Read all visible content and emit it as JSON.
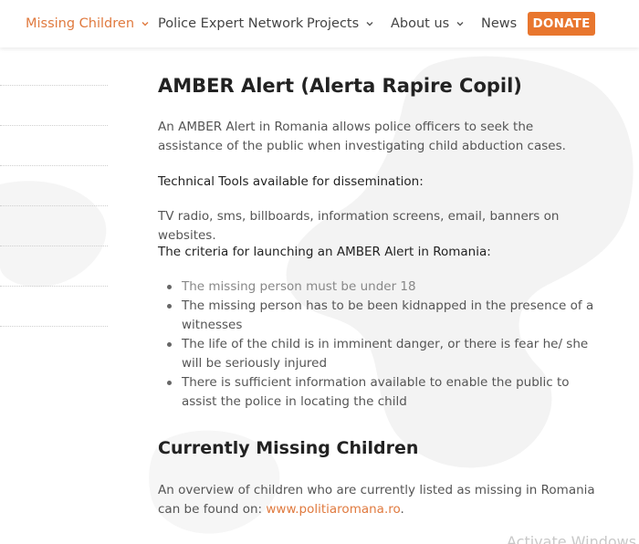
{
  "nav": {
    "items": [
      {
        "label": "Missing Children",
        "has_dropdown": true,
        "active": true
      },
      {
        "label": "Police Expert Network",
        "has_dropdown": false,
        "active": false
      },
      {
        "label": "Projects",
        "has_dropdown": true,
        "active": false
      },
      {
        "label": "About us",
        "has_dropdown": true,
        "active": false
      },
      {
        "label": "News",
        "has_dropdown": false,
        "active": false
      }
    ],
    "donate_label": "DONATE",
    "accent_color": "#e07a3f",
    "donate_color": "#e8762e"
  },
  "main": {
    "title": "AMBER Alert (Alerta Rapire Copil)",
    "intro": "An AMBER Alert in Romania allows police officers to seek the assistance of the public when investigating child abduction cases.",
    "tools_heading": "Technical Tools available for dissemination:",
    "tools_text": "TV radio, sms, billboards, information screens, email, banners on websites.",
    "criteria_heading": "The criteria for launching an AMBER Alert in Romania:",
    "criteria": [
      "The missing person must be under 18",
      "The missing person has to be been kidnapped in the presence of a witnesses",
      "The life of the child is in imminent danger, or there is fear he/ she will be seriously injured",
      "There is sufficient information available to enable the public to assist the police in locating the child"
    ],
    "section_title": "Currently Missing Children",
    "overview_prefix": "An overview of children who are currently listed as missing in Romania can be found on: ",
    "overview_link": "www.politiaromana.ro",
    "overview_suffix": "."
  },
  "watermark": "Activate Windows"
}
